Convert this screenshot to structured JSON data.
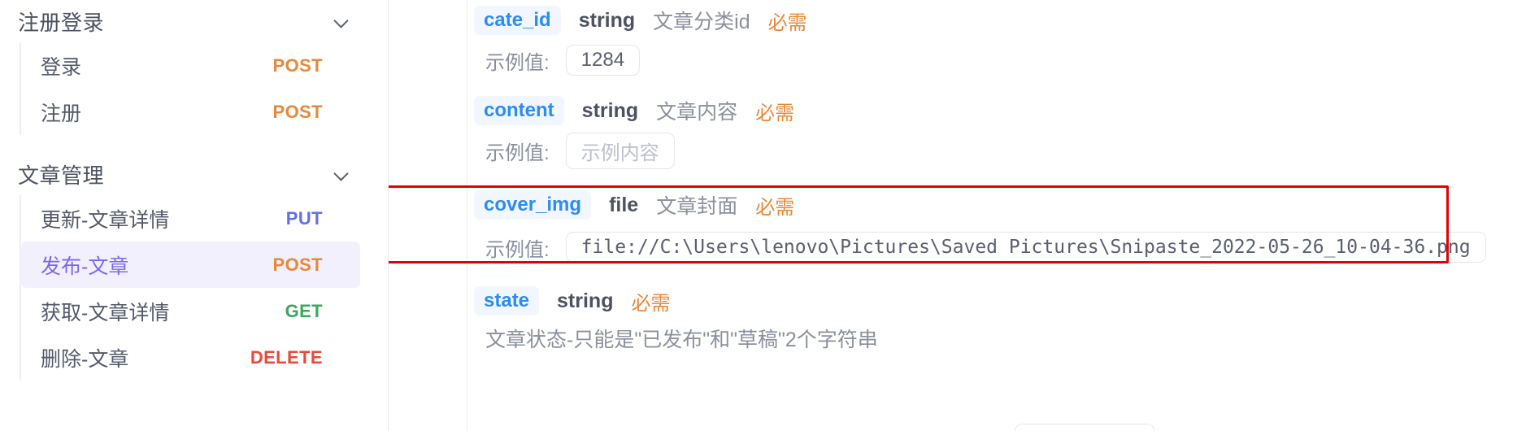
{
  "sidebar": {
    "groups": [
      {
        "title": "注册登录",
        "chevron_icon": "chevron-down-icon",
        "items": [
          {
            "label": "登录",
            "method": "POST",
            "method_class": "m-post",
            "active": false
          },
          {
            "label": "注册",
            "method": "POST",
            "method_class": "m-post",
            "active": false
          }
        ]
      },
      {
        "title": "文章管理",
        "chevron_icon": "chevron-down-icon",
        "items": [
          {
            "label": "更新-文章详情",
            "method": "PUT",
            "method_class": "m-put",
            "active": false
          },
          {
            "label": "发布-文章",
            "method": "POST",
            "method_class": "m-post",
            "active": true
          },
          {
            "label": "获取-文章详情",
            "method": "GET",
            "method_class": "m-get",
            "active": false
          },
          {
            "label": "删除-文章",
            "method": "DELETE",
            "method_class": "m-delete",
            "active": false
          }
        ]
      }
    ]
  },
  "main": {
    "example_label": "示例值:",
    "required_label": "必需",
    "params": [
      {
        "name": "cate_id",
        "type": "string",
        "desc": "文章分类id",
        "required": "必需",
        "example_label": "示例值:",
        "example_value": "1284",
        "is_placeholder": false,
        "highlighted": false
      },
      {
        "name": "content",
        "type": "string",
        "desc": "文章内容",
        "required": "必需",
        "example_label": "示例值:",
        "example_value": "示例内容",
        "is_placeholder": true,
        "highlighted": false
      },
      {
        "name": "cover_img",
        "type": "file",
        "desc": "文章封面",
        "required": "必需",
        "example_label": "示例值:",
        "example_value": "file://C:\\Users\\lenovo\\Pictures\\Saved Pictures\\Snipaste_2022-05-26_10-04-36.png",
        "is_placeholder": false,
        "highlighted": true
      },
      {
        "name": "state",
        "type": "string",
        "desc": "",
        "required": "必需",
        "note": "文章状态-只能是\"已发布\"和\"草稿\"2个字符串"
      }
    ]
  },
  "colors": {
    "accent_purple": "#7b68ee",
    "chip_text": "#2d8cf0",
    "chip_bg": "#f1f6ff",
    "method_post": "#e8883a",
    "method_put": "#6070e8",
    "method_get": "#39a85b",
    "method_delete": "#e8493a",
    "required_orange": "#e8883a",
    "highlight_red": "#e60000",
    "active_row_bg": "#f2f0fd"
  }
}
